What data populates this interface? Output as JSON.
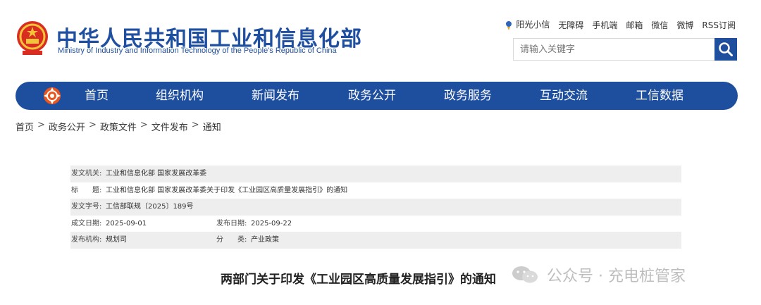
{
  "header": {
    "title": "中华人民共和国工业和信息化部",
    "subtitle": "Ministry of Industry and Information Technology of the People's Republic of China",
    "emblem_icon": "national-emblem-icon"
  },
  "toplinks": [
    "阳光小信",
    "无障碍",
    "手机端",
    "邮箱",
    "微信",
    "微博",
    "RSS订阅"
  ],
  "search": {
    "placeholder": "请输入关键字",
    "icon": "search-icon"
  },
  "nav": {
    "items": [
      "首页",
      "组织机构",
      "新闻发布",
      "政务公开",
      "政务服务",
      "互动交流",
      "工信数据"
    ]
  },
  "breadcrumb": [
    "首页",
    "政务公开",
    "政策文件",
    "文件发布",
    "通知"
  ],
  "info": {
    "issuer_label": "发文机关:",
    "issuer_value": "工业和信息化部 国家发展改革委",
    "title_label": "标　　题:",
    "title_value": "工业和信息化部 国家发展改革委关于印发《工业园区高质量发展指引》的通知",
    "docno_label": "发文字号:",
    "docno_value": "工信部联规〔2025〕189号",
    "date_label": "成文日期:",
    "date_value": "2025-09-01",
    "pubdate_label": "发布日期:",
    "pubdate_value": "2025-09-22",
    "org_label": "发布机构:",
    "org_value": "规划司",
    "category_label": "分　　类:",
    "category_value": "产业政策"
  },
  "article": {
    "title": "两部门关于印发《工业园区高质量发展指引》的通知"
  },
  "watermark": {
    "text": "公众号 · 充电桩管家"
  },
  "colors": {
    "primary": "#1e4e9e",
    "title_blue": "#1f4fa0",
    "shade": "#eeeeee"
  }
}
